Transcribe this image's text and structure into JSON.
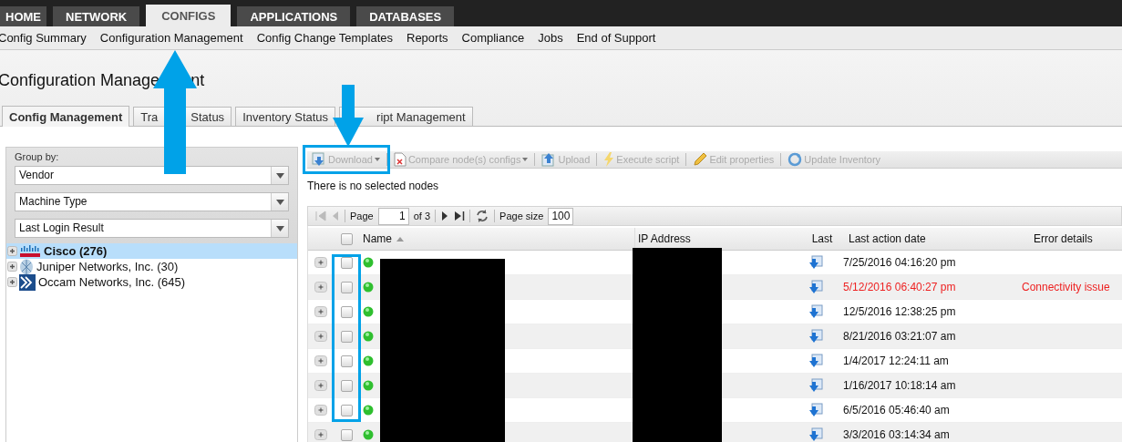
{
  "nav_tabs": [
    {
      "label": "HOME",
      "selected": false
    },
    {
      "label": "NETWORK",
      "selected": false
    },
    {
      "label": "CONFIGS",
      "selected": true
    },
    {
      "label": "APPLICATIONS",
      "selected": false
    },
    {
      "label": "DATABASES",
      "selected": false
    }
  ],
  "sub_nav": [
    "Config Summary",
    "Configuration Management",
    "Config Change Templates",
    "Reports",
    "Compliance",
    "Jobs",
    "End of Support"
  ],
  "page_title": [
    "Configuration Manage",
    "nt"
  ],
  "tabs": [
    {
      "label": [
        "Config Management"
      ],
      "selected": true
    },
    {
      "label": [
        "Tra",
        "Status"
      ],
      "selected": false
    },
    {
      "label": [
        "Inventory Status"
      ],
      "selected": false
    },
    {
      "label": [
        "ript Management"
      ],
      "selected": false
    }
  ],
  "group_by": {
    "label": "Group by:",
    "selects": [
      "Vendor",
      "Machine Type",
      "Last Login Result"
    ]
  },
  "tree": [
    {
      "label": "Cisco (276)",
      "selected": true,
      "expanded": false
    },
    {
      "label": "Juniper Networks, Inc. (30)",
      "selected": false,
      "expanded": false
    },
    {
      "label": "Occam Networks, Inc. (645)",
      "selected": false,
      "expanded": false
    }
  ],
  "toolbar": [
    {
      "label": "Download",
      "dropdown": true,
      "disabled": true
    },
    {
      "label": "Compare node(s) configs",
      "dropdown": true,
      "disabled": true
    },
    {
      "label": "Upload",
      "dropdown": false,
      "disabled": true
    },
    {
      "label": "Execute script",
      "dropdown": false,
      "disabled": true
    },
    {
      "label": "Edit properties",
      "dropdown": false,
      "disabled": true
    },
    {
      "label": "Update Inventory",
      "dropdown": false,
      "disabled": true
    }
  ],
  "selection_message": "There is no selected nodes",
  "pager": {
    "page_label": "Page",
    "page": "1",
    "of": "of 3",
    "size_label": "Page size",
    "size": "100"
  },
  "table": {
    "columns": [
      {
        "label": "Name",
        "sorted": true
      },
      {
        "label": "IP Address",
        "sorted": false
      },
      {
        "label": "Last",
        "sorted": false
      },
      {
        "label": "Last action date",
        "sorted": false
      },
      {
        "label": "Error details",
        "sorted": false
      }
    ],
    "header_checked": false,
    "rows": [
      {
        "checked": false,
        "error": false,
        "date": "7/25/2016 04:16:20 pm"
      },
      {
        "checked": false,
        "error": true,
        "date": "5/12/2016 06:40:27 pm",
        "error_text": "Connectivity issue"
      },
      {
        "checked": false,
        "error": false,
        "date": "12/5/2016 12:38:25 pm"
      },
      {
        "checked": false,
        "error": false,
        "date": "8/21/2016 03:21:07 am"
      },
      {
        "checked": false,
        "error": false,
        "date": "1/4/2017 12:24:11 am"
      },
      {
        "checked": false,
        "error": false,
        "date": "1/16/2017 10:18:14 am"
      },
      {
        "checked": false,
        "error": false,
        "date": "6/5/2016 05:46:40 am"
      },
      {
        "checked": false,
        "error": false,
        "date": "3/3/2016 03:14:34 am"
      }
    ]
  }
}
